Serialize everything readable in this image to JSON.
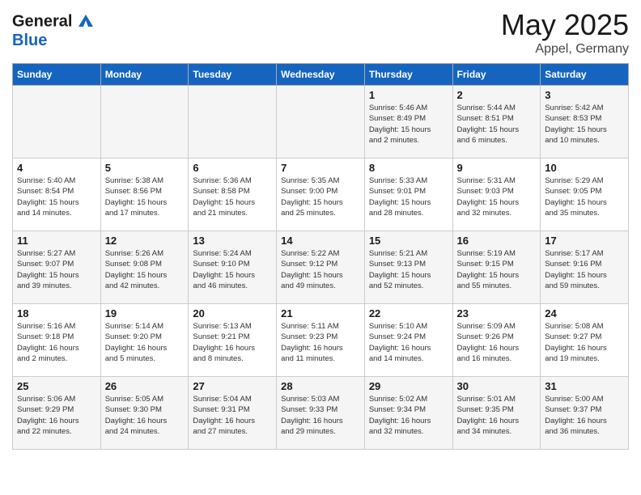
{
  "header": {
    "logo_general": "General",
    "logo_blue": "Blue",
    "title": "May 2025",
    "location": "Appel, Germany"
  },
  "weekdays": [
    "Sunday",
    "Monday",
    "Tuesday",
    "Wednesday",
    "Thursday",
    "Friday",
    "Saturday"
  ],
  "weeks": [
    [
      {
        "day": "",
        "info": ""
      },
      {
        "day": "",
        "info": ""
      },
      {
        "day": "",
        "info": ""
      },
      {
        "day": "",
        "info": ""
      },
      {
        "day": "1",
        "info": "Sunrise: 5:46 AM\nSunset: 8:49 PM\nDaylight: 15 hours\nand 2 minutes."
      },
      {
        "day": "2",
        "info": "Sunrise: 5:44 AM\nSunset: 8:51 PM\nDaylight: 15 hours\nand 6 minutes."
      },
      {
        "day": "3",
        "info": "Sunrise: 5:42 AM\nSunset: 8:53 PM\nDaylight: 15 hours\nand 10 minutes."
      }
    ],
    [
      {
        "day": "4",
        "info": "Sunrise: 5:40 AM\nSunset: 8:54 PM\nDaylight: 15 hours\nand 14 minutes."
      },
      {
        "day": "5",
        "info": "Sunrise: 5:38 AM\nSunset: 8:56 PM\nDaylight: 15 hours\nand 17 minutes."
      },
      {
        "day": "6",
        "info": "Sunrise: 5:36 AM\nSunset: 8:58 PM\nDaylight: 15 hours\nand 21 minutes."
      },
      {
        "day": "7",
        "info": "Sunrise: 5:35 AM\nSunset: 9:00 PM\nDaylight: 15 hours\nand 25 minutes."
      },
      {
        "day": "8",
        "info": "Sunrise: 5:33 AM\nSunset: 9:01 PM\nDaylight: 15 hours\nand 28 minutes."
      },
      {
        "day": "9",
        "info": "Sunrise: 5:31 AM\nSunset: 9:03 PM\nDaylight: 15 hours\nand 32 minutes."
      },
      {
        "day": "10",
        "info": "Sunrise: 5:29 AM\nSunset: 9:05 PM\nDaylight: 15 hours\nand 35 minutes."
      }
    ],
    [
      {
        "day": "11",
        "info": "Sunrise: 5:27 AM\nSunset: 9:07 PM\nDaylight: 15 hours\nand 39 minutes."
      },
      {
        "day": "12",
        "info": "Sunrise: 5:26 AM\nSunset: 9:08 PM\nDaylight: 15 hours\nand 42 minutes."
      },
      {
        "day": "13",
        "info": "Sunrise: 5:24 AM\nSunset: 9:10 PM\nDaylight: 15 hours\nand 46 minutes."
      },
      {
        "day": "14",
        "info": "Sunrise: 5:22 AM\nSunset: 9:12 PM\nDaylight: 15 hours\nand 49 minutes."
      },
      {
        "day": "15",
        "info": "Sunrise: 5:21 AM\nSunset: 9:13 PM\nDaylight: 15 hours\nand 52 minutes."
      },
      {
        "day": "16",
        "info": "Sunrise: 5:19 AM\nSunset: 9:15 PM\nDaylight: 15 hours\nand 55 minutes."
      },
      {
        "day": "17",
        "info": "Sunrise: 5:17 AM\nSunset: 9:16 PM\nDaylight: 15 hours\nand 59 minutes."
      }
    ],
    [
      {
        "day": "18",
        "info": "Sunrise: 5:16 AM\nSunset: 9:18 PM\nDaylight: 16 hours\nand 2 minutes."
      },
      {
        "day": "19",
        "info": "Sunrise: 5:14 AM\nSunset: 9:20 PM\nDaylight: 16 hours\nand 5 minutes."
      },
      {
        "day": "20",
        "info": "Sunrise: 5:13 AM\nSunset: 9:21 PM\nDaylight: 16 hours\nand 8 minutes."
      },
      {
        "day": "21",
        "info": "Sunrise: 5:11 AM\nSunset: 9:23 PM\nDaylight: 16 hours\nand 11 minutes."
      },
      {
        "day": "22",
        "info": "Sunrise: 5:10 AM\nSunset: 9:24 PM\nDaylight: 16 hours\nand 14 minutes."
      },
      {
        "day": "23",
        "info": "Sunrise: 5:09 AM\nSunset: 9:26 PM\nDaylight: 16 hours\nand 16 minutes."
      },
      {
        "day": "24",
        "info": "Sunrise: 5:08 AM\nSunset: 9:27 PM\nDaylight: 16 hours\nand 19 minutes."
      }
    ],
    [
      {
        "day": "25",
        "info": "Sunrise: 5:06 AM\nSunset: 9:29 PM\nDaylight: 16 hours\nand 22 minutes."
      },
      {
        "day": "26",
        "info": "Sunrise: 5:05 AM\nSunset: 9:30 PM\nDaylight: 16 hours\nand 24 minutes."
      },
      {
        "day": "27",
        "info": "Sunrise: 5:04 AM\nSunset: 9:31 PM\nDaylight: 16 hours\nand 27 minutes."
      },
      {
        "day": "28",
        "info": "Sunrise: 5:03 AM\nSunset: 9:33 PM\nDaylight: 16 hours\nand 29 minutes."
      },
      {
        "day": "29",
        "info": "Sunrise: 5:02 AM\nSunset: 9:34 PM\nDaylight: 16 hours\nand 32 minutes."
      },
      {
        "day": "30",
        "info": "Sunrise: 5:01 AM\nSunset: 9:35 PM\nDaylight: 16 hours\nand 34 minutes."
      },
      {
        "day": "31",
        "info": "Sunrise: 5:00 AM\nSunset: 9:37 PM\nDaylight: 16 hours\nand 36 minutes."
      }
    ]
  ]
}
